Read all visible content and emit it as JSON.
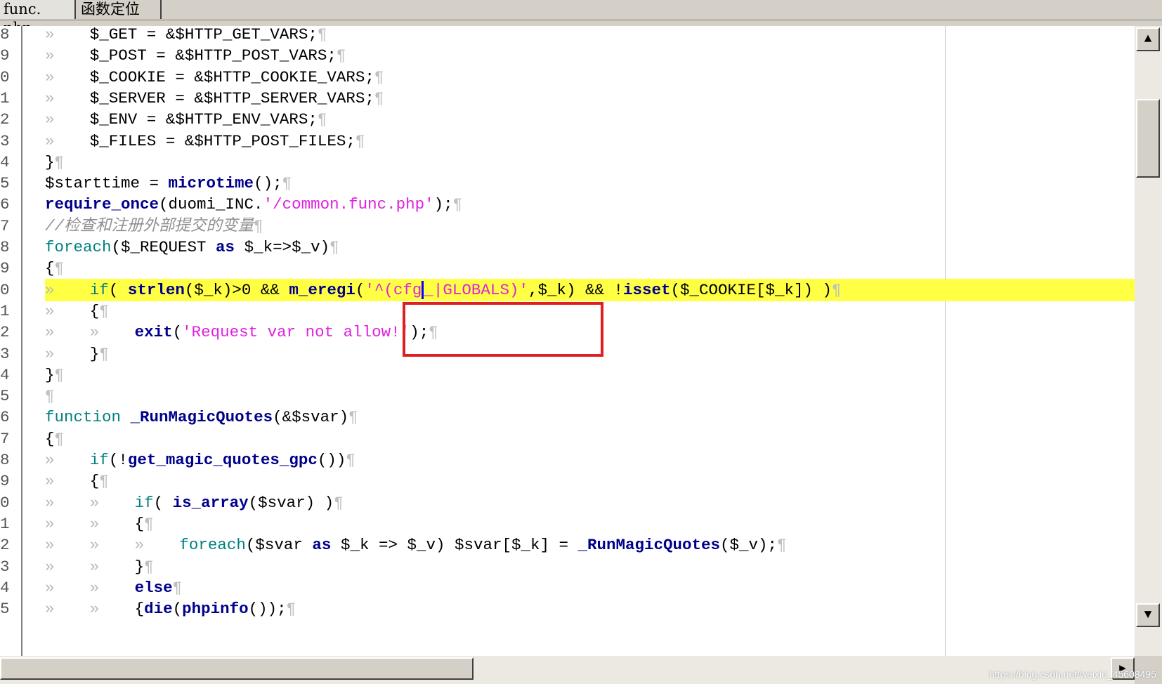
{
  "tabs": [
    {
      "label": "func. php"
    },
    {
      "label": "函数定位"
    }
  ],
  "editor": {
    "lines": [
      {
        "no": "8",
        "indent": 1,
        "tokens": [
          [
            "var",
            "$_GET = &$HTTP_GET_VARS;"
          ]
        ]
      },
      {
        "no": "9",
        "indent": 1,
        "tokens": [
          [
            "var",
            "$_POST = &$HTTP_POST_VARS;"
          ]
        ]
      },
      {
        "no": "0",
        "indent": 1,
        "tokens": [
          [
            "var",
            "$_COOKIE = &$HTTP_COOKIE_VARS;"
          ]
        ]
      },
      {
        "no": "1",
        "indent": 1,
        "tokens": [
          [
            "var",
            "$_SERVER = &$HTTP_SERVER_VARS;"
          ]
        ]
      },
      {
        "no": "2",
        "indent": 1,
        "tokens": [
          [
            "var",
            "$_ENV = &$HTTP_ENV_VARS;"
          ]
        ]
      },
      {
        "no": "3",
        "indent": 1,
        "tokens": [
          [
            "var",
            "$_FILES = &$HTTP_POST_FILES;"
          ]
        ]
      },
      {
        "no": "4",
        "indent": 0,
        "tokens": [
          [
            "op",
            "}"
          ]
        ]
      },
      {
        "no": "5",
        "indent": 0,
        "tokens": [
          [
            "var",
            "$starttime = "
          ],
          [
            "kw",
            "microtime"
          ],
          [
            "op",
            "();"
          ]
        ]
      },
      {
        "no": "6",
        "indent": 0,
        "tokens": [
          [
            "kw",
            "require_once"
          ],
          [
            "op",
            "(duomi_INC."
          ],
          [
            "str",
            "'/common.func.php'"
          ],
          [
            "op",
            ");"
          ]
        ]
      },
      {
        "no": "7",
        "indent": 0,
        "tokens": [
          [
            "cmt",
            "//检查和注册外部提交的变量"
          ]
        ]
      },
      {
        "no": "8",
        "indent": 0,
        "tokens": [
          [
            "kwt",
            "foreach"
          ],
          [
            "op",
            "($_REQUEST "
          ],
          [
            "kw",
            "as"
          ],
          [
            "op",
            " $_k=>$_v)"
          ]
        ]
      },
      {
        "no": "9",
        "indent": 0,
        "tokens": [
          [
            "op",
            "{"
          ]
        ]
      },
      {
        "no": "0",
        "indent": 1,
        "highlight": true,
        "tokens": [
          [
            "kwt",
            "if"
          ],
          [
            "op",
            "( "
          ],
          [
            "kw",
            "strlen"
          ],
          [
            "op",
            "($_k)>0 && "
          ],
          [
            "kw",
            "m_eregi"
          ],
          [
            "op",
            "("
          ],
          [
            "str",
            "'^(cfg"
          ],
          [
            "caret",
            ""
          ],
          [
            "str",
            "_|GLOBALS)'"
          ],
          [
            "op",
            ",$_k) && !"
          ],
          [
            "kw",
            "isset"
          ],
          [
            "op",
            "($_COOKIE[$_k]) )"
          ]
        ]
      },
      {
        "no": "1",
        "indent": 1,
        "tokens": [
          [
            "op",
            "{"
          ]
        ]
      },
      {
        "no": "2",
        "indent": 2,
        "tokens": [
          [
            "kw",
            "exit"
          ],
          [
            "op",
            "("
          ],
          [
            "str",
            "'Request var not allow!'"
          ],
          [
            "op",
            ");"
          ]
        ]
      },
      {
        "no": "3",
        "indent": 1,
        "tokens": [
          [
            "op",
            "}"
          ]
        ]
      },
      {
        "no": "4",
        "indent": 0,
        "tokens": [
          [
            "op",
            "}"
          ]
        ]
      },
      {
        "no": "5",
        "indent": 0,
        "tokens": []
      },
      {
        "no": "6",
        "indent": 0,
        "tokens": [
          [
            "kwt",
            "function"
          ],
          [
            "op",
            " "
          ],
          [
            "kw",
            "_RunMagicQuotes"
          ],
          [
            "op",
            "(&$svar)"
          ]
        ]
      },
      {
        "no": "7",
        "indent": 0,
        "tokens": [
          [
            "op",
            "{"
          ]
        ]
      },
      {
        "no": "8",
        "indent": 1,
        "tokens": [
          [
            "kwt",
            "if"
          ],
          [
            "op",
            "(!"
          ],
          [
            "kw",
            "get_magic_quotes_gpc"
          ],
          [
            "op",
            "())"
          ]
        ]
      },
      {
        "no": "9",
        "indent": 1,
        "tokens": [
          [
            "op",
            "{"
          ]
        ]
      },
      {
        "no": "0",
        "indent": 2,
        "tokens": [
          [
            "kwt",
            "if"
          ],
          [
            "op",
            "( "
          ],
          [
            "kw",
            "is_array"
          ],
          [
            "op",
            "($svar) )"
          ]
        ]
      },
      {
        "no": "1",
        "indent": 2,
        "tokens": [
          [
            "op",
            "{"
          ]
        ]
      },
      {
        "no": "2",
        "indent": 3,
        "tokens": [
          [
            "kwt",
            "foreach"
          ],
          [
            "op",
            "($svar "
          ],
          [
            "kw",
            "as"
          ],
          [
            "op",
            " $_k => $_v) $svar[$_k] = "
          ],
          [
            "kw",
            "_RunMagicQuotes"
          ],
          [
            "op",
            "($_v);"
          ]
        ]
      },
      {
        "no": "3",
        "indent": 2,
        "tokens": [
          [
            "op",
            "}"
          ]
        ]
      },
      {
        "no": "4",
        "indent": 2,
        "tokens": [
          [
            "kw",
            "else"
          ]
        ]
      },
      {
        "no": "5",
        "indent": 2,
        "tokens": [
          [
            "op",
            "{"
          ],
          [
            "kw",
            "die"
          ],
          [
            "op",
            "("
          ],
          [
            "kw",
            "phpinfo"
          ],
          [
            "op",
            "());"
          ]
        ]
      }
    ],
    "tab_marker": "»",
    "eol_marker": "¶"
  },
  "scrollbar": {
    "up_icon": "▲",
    "down_icon": "▼",
    "right_icon": "▶"
  },
  "watermark": "https://blog.csdn.net/weixin_45608495",
  "colors": {
    "highlight_line": "#ffff44",
    "annotation_box": "#e02020",
    "keyword": "#00008b",
    "string": "#e020e0",
    "comment": "#909090",
    "caret": "#0000ff"
  }
}
